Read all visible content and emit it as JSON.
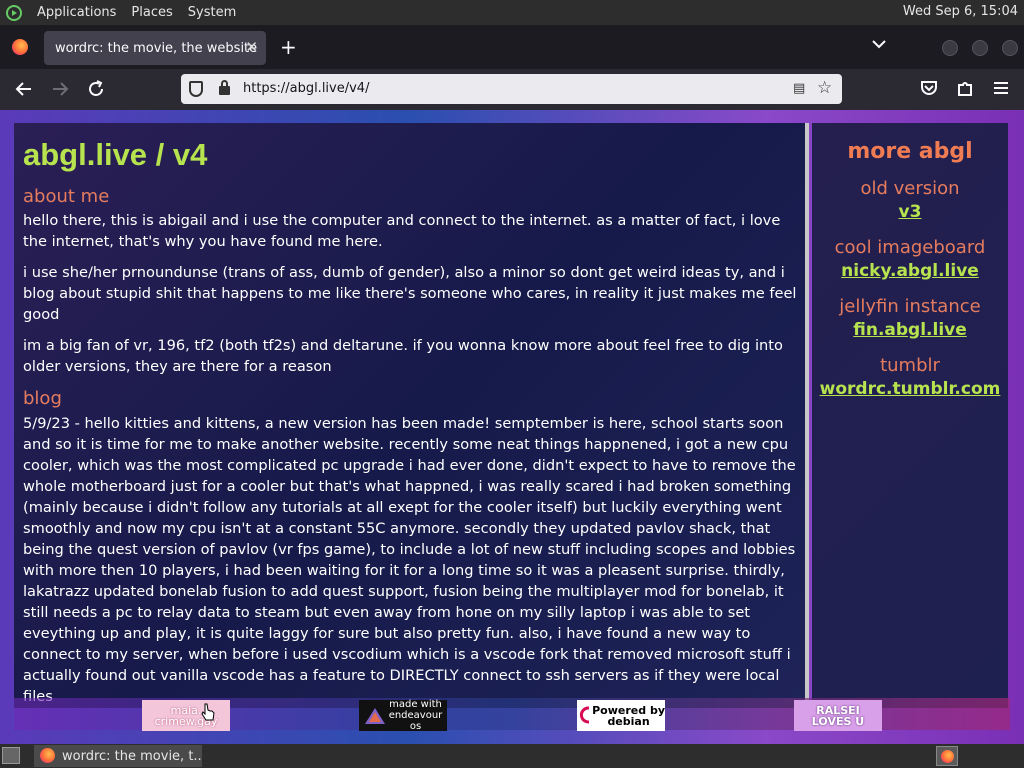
{
  "top_panel": {
    "menus": [
      "Applications",
      "Places",
      "System"
    ],
    "clock": "Wed Sep  6, 15:04"
  },
  "browser": {
    "tab_title": "wordrc: the movie, the website",
    "tab_close": "✕",
    "new_tab": "+",
    "tab_list": "⌄",
    "url": "https://abgl.live/v4/"
  },
  "page": {
    "title": "abgl.live / v4",
    "about": {
      "heading": "about me",
      "paragraphs": [
        "hello there, this is abigail and i use the computer and connect to the internet. as a matter of fact, i love the internet, that's why you have found me here.",
        "i use she/her prnoundunse (trans of ass, dumb of gender), also a minor so dont get weird ideas ty, and i blog about stupid shit that happens to me like there's someone who cares, in reality it just makes me feel good",
        "im a big fan of vr, 196, tf2 (both tf2s) and deltarune. if you wonna know more about feel free to dig into older versions, they are there for a reason"
      ]
    },
    "blog": {
      "heading": "blog",
      "post": "5/9/23 - hello kitties and kittens, a new version has been made! semptember is here, school starts soon and so it is time for me to make another website. recently some neat things happnened, i got a new cpu cooler, which was the most complicated pc upgrade i had ever done, didn't expect to have to remove the whole motherboard just for a cooler but that's what happned, i was really scared i had broken something (mainly because i didn't follow any tutorials at all exept for the cooler itself) but luckily everything went smoothly and now my cpu isn't at a constant 55C anymore. secondly they updated pavlov shack, that being the quest version of pavlov (vr fps game), to include a lot of new stuff including scopes and lobbies with more then 10 players, i had been waiting for it for a long time so it was a pleasent surprise. thirdly, lakatrazz updated bonelab fusion to add quest support, fusion being the multiplayer mod for bonelab, it still needs a pc to relay data to steam but even away from hone on my silly laptop i was able to set eveything up and play, it is quite laggy for sure but also pretty fun. also, i have found a new way to connect to my server, when before i used vscodium which is a vscode fork that removed microsoft stuff i actually found out vanilla vscode has a feature to DIRECTLY connect to ssh servers as if they were local files"
    },
    "sidebar": {
      "title": "more abgl",
      "groups": [
        {
          "label": "old version",
          "link": "v3"
        },
        {
          "label": "cool imageboard",
          "link": "nicky.abgl.live"
        },
        {
          "label": "jellyfin instance",
          "link": "fin.abgl.live"
        },
        {
          "label": "tumblr",
          "link": "wordrc.tumblr.com"
        }
      ]
    },
    "badges": [
      {
        "text": "maia.\ncrimew.gay"
      },
      {
        "text": "made with\nendeavour\nos"
      },
      {
        "text": "Powered by\ndebian"
      },
      {
        "text": "RALSEI\nLOVES U"
      }
    ]
  },
  "taskbar": {
    "window_title": "wordrc: the movie, t..."
  }
}
